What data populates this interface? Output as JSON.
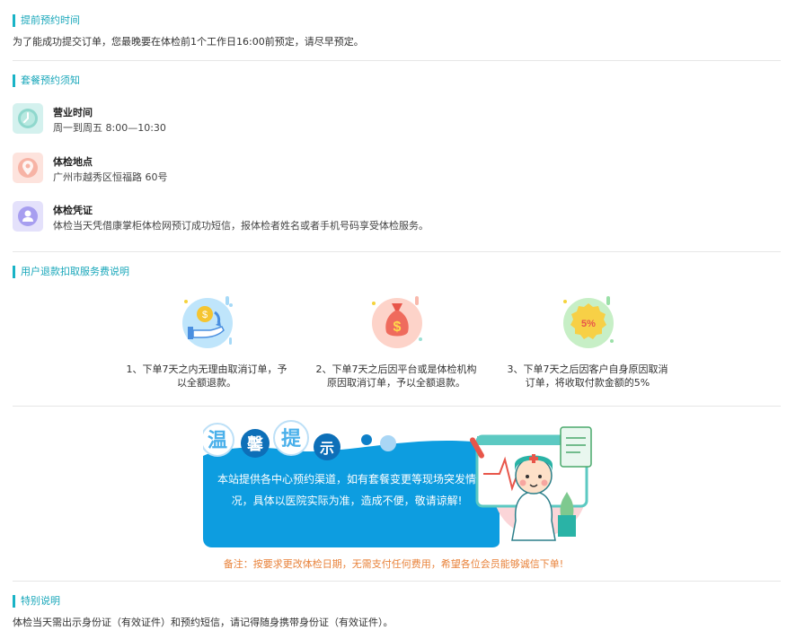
{
  "advance": {
    "title": "提前预约时间",
    "text": "为了能成功提交订单，您最晚要在体检前1个工作日16:00前预定，请尽早预定。"
  },
  "notice": {
    "title": "套餐预约须知",
    "items": [
      {
        "icon": "clock-icon",
        "title": "营业时间",
        "text": "周一到周五 8:00—10:30"
      },
      {
        "icon": "location-icon",
        "title": "体检地点",
        "text": "广州市越秀区恒福路 60号"
      },
      {
        "icon": "user-icon",
        "title": "体检凭证",
        "text": "体检当天凭借康掌柜体检网预订成功短信，报体检者姓名或者手机号码享受体检服务。"
      }
    ]
  },
  "refund": {
    "title": "用户退款扣取服务费说明",
    "items": [
      {
        "icon": "coin-hand-icon",
        "line1": "1、下单7天之内无理由取消订单，予",
        "line2": "以全额退款。"
      },
      {
        "icon": "money-bag-icon",
        "line1": "2、下单7天之后因平台或是体检机构",
        "line2": "原因取消订单，予以全额退款。"
      },
      {
        "icon": "percent-badge-icon",
        "badge": "5%",
        "line1": "3、下单7天之后因客户自身原因取消",
        "line2": "订单，将收取付款金额的5%"
      }
    ]
  },
  "banner": {
    "chars": [
      "温",
      "馨",
      "提",
      "示"
    ],
    "line1": "本站提供各中心预约渠道，如有套餐变更等现场突发情",
    "line2": "况，具体以医院实际为准，造成不便，敬请谅解!"
  },
  "remark": "备注：按要求更改体检日期，无需支付任何费用，希望各位会员能够诚信下单!",
  "special": {
    "title": "特别说明",
    "text": "体检当天需出示身份证（有效证件）和预约短信，请记得随身携带身份证（有效证件）。"
  },
  "colors": {
    "accent": "#19b3c6",
    "banner_blue": "#0d9de0",
    "note_orange": "#e8823a"
  }
}
